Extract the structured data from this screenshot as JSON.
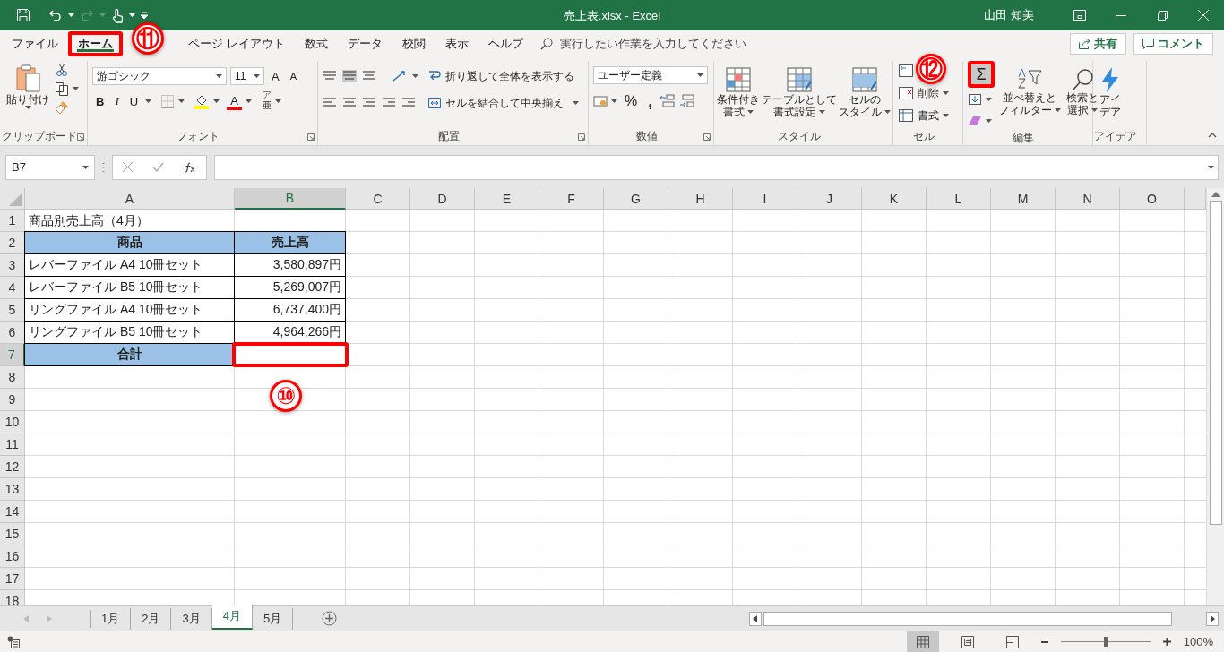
{
  "title_bar": {
    "title": "売上表.xlsx  -  Excel",
    "user": "山田 知美"
  },
  "menu_tabs": [
    {
      "label": "ファイル",
      "selected": false,
      "highlighted": false
    },
    {
      "label": "ホーム",
      "selected": true,
      "highlighted": true,
      "callout": "⑪"
    },
    {
      "label": "ページ レイアウト",
      "selected": false,
      "highlighted": false
    },
    {
      "label": "数式",
      "selected": false,
      "highlighted": false
    },
    {
      "label": "データ",
      "selected": false,
      "highlighted": false
    },
    {
      "label": "校閲",
      "selected": false,
      "highlighted": false
    },
    {
      "label": "表示",
      "selected": false,
      "highlighted": false
    },
    {
      "label": "ヘルプ",
      "selected": false,
      "highlighted": false
    }
  ],
  "tell_me": {
    "placeholder": "実行したい作業を入力してください"
  },
  "share_button": "共有",
  "comment_button": "コメント",
  "ribbon": {
    "clipboard": {
      "paste": "貼り付け",
      "label": "クリップボード"
    },
    "font": {
      "name": "游ゴシック",
      "size": "11",
      "grow": "A",
      "shrink": "A",
      "bold": "B",
      "italic": "I",
      "underline": "U",
      "foreground": "A",
      "phonetic_top": "ア",
      "phonetic": "亜",
      "label": "フォント"
    },
    "alignment": {
      "wrap": "折り返して全体を表示する",
      "merge": "セルを結合して中央揃え",
      "label": "配置"
    },
    "number": {
      "format": "ユーザー定義",
      "percent": "%",
      "comma": ",",
      "label": "数値"
    },
    "styles": {
      "buttons": [
        {
          "lines": [
            "条件付き",
            "書式"
          ]
        },
        {
          "lines": [
            "テーブルとして",
            "書式設定"
          ]
        },
        {
          "lines": [
            "セルの",
            "スタイル"
          ]
        }
      ],
      "label": "スタイル"
    },
    "cells": {
      "callout": "⑫",
      "delete": "削除",
      "format": "書式",
      "label": "セル"
    },
    "editing": {
      "autosum": "Σ",
      "autosum_highlighted": true,
      "sort": [
        "並べ替えと",
        "フィルター"
      ],
      "find": [
        "検索と",
        "選択"
      ],
      "label": "編集"
    },
    "ideas": {
      "lines": [
        "アイ",
        "デア"
      ],
      "label": "アイデア"
    }
  },
  "name_box": "B7",
  "columns": [
    {
      "label": "A",
      "selected": false
    },
    {
      "label": "B",
      "selected": true
    },
    {
      "label": "C",
      "selected": false
    },
    {
      "label": "D",
      "selected": false
    },
    {
      "label": "E",
      "selected": false
    },
    {
      "label": "F",
      "selected": false
    },
    {
      "label": "G",
      "selected": false
    },
    {
      "label": "H",
      "selected": false
    },
    {
      "label": "I",
      "selected": false
    },
    {
      "label": "J",
      "selected": false
    },
    {
      "label": "K",
      "selected": false
    },
    {
      "label": "L",
      "selected": false
    },
    {
      "label": "M",
      "selected": false
    },
    {
      "label": "N",
      "selected": false
    },
    {
      "label": "O",
      "selected": false
    }
  ],
  "rows": [
    {
      "number": "1",
      "selected": false,
      "cells": [
        {
          "text": "商品別売上高（4月）",
          "kind": "plain"
        }
      ]
    },
    {
      "number": "2",
      "selected": false,
      "cells": [
        {
          "text": "商品",
          "kind": "header"
        },
        {
          "text": "売上高",
          "kind": "header"
        }
      ]
    },
    {
      "number": "3",
      "selected": false,
      "cells": [
        {
          "text": "レバーファイル A4 10冊セット",
          "kind": "body"
        },
        {
          "text": "3,580,897円",
          "kind": "amount"
        }
      ]
    },
    {
      "number": "4",
      "selected": false,
      "cells": [
        {
          "text": "レバーファイル B5 10冊セット",
          "kind": "body"
        },
        {
          "text": "5,269,007円",
          "kind": "amount"
        }
      ]
    },
    {
      "number": "5",
      "selected": false,
      "cells": [
        {
          "text": "リングファイル A4 10冊セット",
          "kind": "body"
        },
        {
          "text": "6,737,400円",
          "kind": "amount"
        }
      ]
    },
    {
      "number": "6",
      "selected": false,
      "cells": [
        {
          "text": "リングファイル B5 10冊セット",
          "kind": "body"
        },
        {
          "text": "4,964,266円",
          "kind": "amount"
        }
      ]
    },
    {
      "number": "7",
      "selected": true,
      "cells": [
        {
          "text": "合計",
          "kind": "header"
        },
        {
          "kind": "amount",
          "highlighted": true,
          "callout": "⑩"
        }
      ]
    },
    {
      "number": "8",
      "selected": false
    },
    {
      "number": "9",
      "selected": false
    },
    {
      "number": "10",
      "selected": false
    },
    {
      "number": "11",
      "selected": false
    },
    {
      "number": "12",
      "selected": false
    },
    {
      "number": "13",
      "selected": false
    },
    {
      "number": "14",
      "selected": false
    },
    {
      "number": "15",
      "selected": false
    },
    {
      "number": "16",
      "selected": false
    },
    {
      "number": "17",
      "selected": false
    },
    {
      "number": "18",
      "selected": false
    }
  ],
  "sheet_tabs": [
    {
      "label": "1月",
      "selected": false
    },
    {
      "label": "2月",
      "selected": false
    },
    {
      "label": "3月",
      "selected": false
    },
    {
      "label": "4月",
      "selected": true
    },
    {
      "label": "5月",
      "selected": false
    }
  ],
  "status_bar": {
    "zoom": {
      "level": 0.5,
      "reading": "100%"
    }
  }
}
